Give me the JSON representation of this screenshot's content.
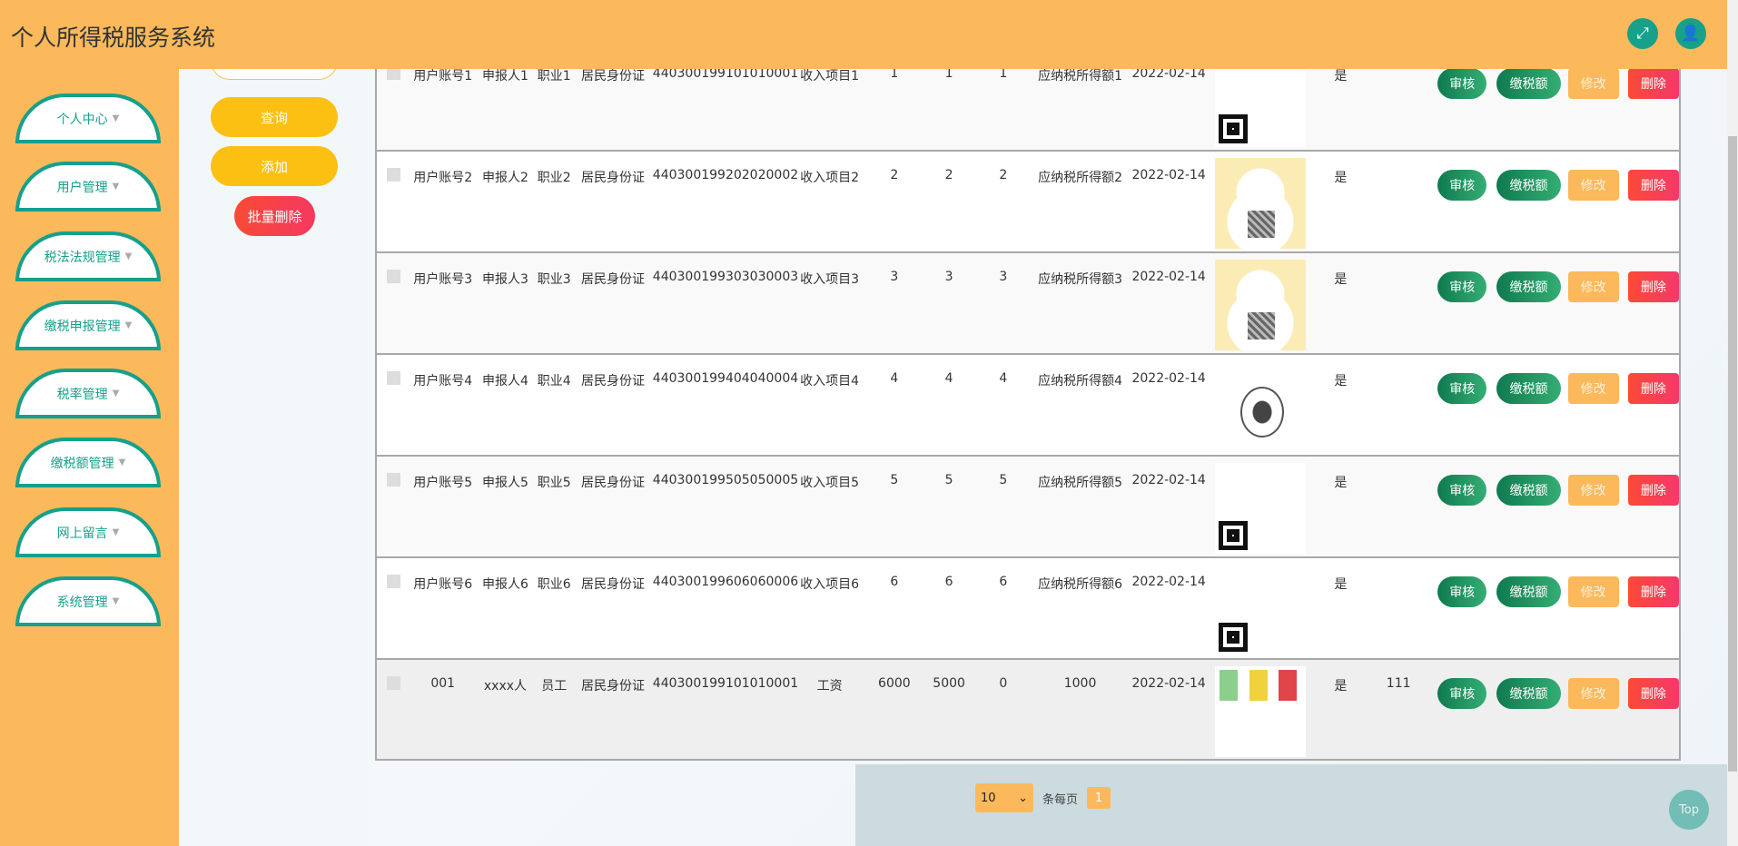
{
  "header": {
    "title": "个人所得税服务系统",
    "icons": [
      "fullscreen-icon",
      "user-icon"
    ]
  },
  "sidebar": {
    "items": [
      {
        "label": "个人中心"
      },
      {
        "label": "用户管理"
      },
      {
        "label": "税法法规管理"
      },
      {
        "label": "缴税申报管理"
      },
      {
        "label": "税率管理"
      },
      {
        "label": "缴税额管理"
      },
      {
        "label": "网上留言"
      },
      {
        "label": "系统管理"
      }
    ]
  },
  "search": {
    "query": "查询",
    "add": "添加",
    "batch_delete": "批量删除"
  },
  "actions": {
    "review": "审核",
    "tax": "缴税额",
    "edit": "修改",
    "delete": "删除"
  },
  "rows": [
    {
      "account": "用户账号1",
      "reporter": "申报人1",
      "job": "职业1",
      "id_type": "居民身份证",
      "id_no": "440300199101010001",
      "income_item": "收入项目1",
      "a": "1",
      "b": "1",
      "c": "1",
      "due": "应纳税所得额1",
      "date": "2022-02-14",
      "image": "qr",
      "flag": "是",
      "note": ""
    },
    {
      "account": "用户账号2",
      "reporter": "申报人2",
      "job": "职业2",
      "id_type": "居民身份证",
      "id_no": "440300199202020002",
      "income_item": "收入项目2",
      "a": "2",
      "b": "2",
      "c": "2",
      "due": "应纳税所得额2",
      "date": "2022-02-14",
      "image": "cartoon",
      "flag": "是",
      "note": ""
    },
    {
      "account": "用户账号3",
      "reporter": "申报人3",
      "job": "职业3",
      "id_type": "居民身份证",
      "id_no": "440300199303030003",
      "income_item": "收入项目3",
      "a": "3",
      "b": "3",
      "c": "3",
      "due": "应纳税所得额3",
      "date": "2022-02-14",
      "image": "cartoon",
      "flag": "是",
      "note": ""
    },
    {
      "account": "用户账号4",
      "reporter": "申报人4",
      "job": "职业4",
      "id_type": "居民身份证",
      "id_no": "440300199404040004",
      "income_item": "收入项目4",
      "a": "4",
      "b": "4",
      "c": "4",
      "due": "应纳税所得额4",
      "date": "2022-02-14",
      "image": "sketch",
      "flag": "是",
      "note": ""
    },
    {
      "account": "用户账号5",
      "reporter": "申报人5",
      "job": "职业5",
      "id_type": "居民身份证",
      "id_no": "440300199505050005",
      "income_item": "收入项目5",
      "a": "5",
      "b": "5",
      "c": "5",
      "due": "应纳税所得额5",
      "date": "2022-02-14",
      "image": "qr",
      "flag": "是",
      "note": ""
    },
    {
      "account": "用户账号6",
      "reporter": "申报人6",
      "job": "职业6",
      "id_type": "居民身份证",
      "id_no": "440300199606060006",
      "income_item": "收入项目6",
      "a": "6",
      "b": "6",
      "c": "6",
      "due": "应纳税所得额6",
      "date": "2022-02-14",
      "image": "qr",
      "flag": "是",
      "note": ""
    },
    {
      "account": "001",
      "reporter": "xxxx人",
      "job": "员工",
      "id_type": "居民身份证",
      "id_no": "440300199101010001",
      "income_item": "工资",
      "a": "6000",
      "b": "5000",
      "c": "0",
      "due": "1000",
      "date": "2022-02-14",
      "image": "seals",
      "flag": "是",
      "note": "111"
    }
  ],
  "pagination": {
    "page_size": "10",
    "per_page_label": "条每页",
    "current_page": "1"
  },
  "back_to_top": "Top"
}
